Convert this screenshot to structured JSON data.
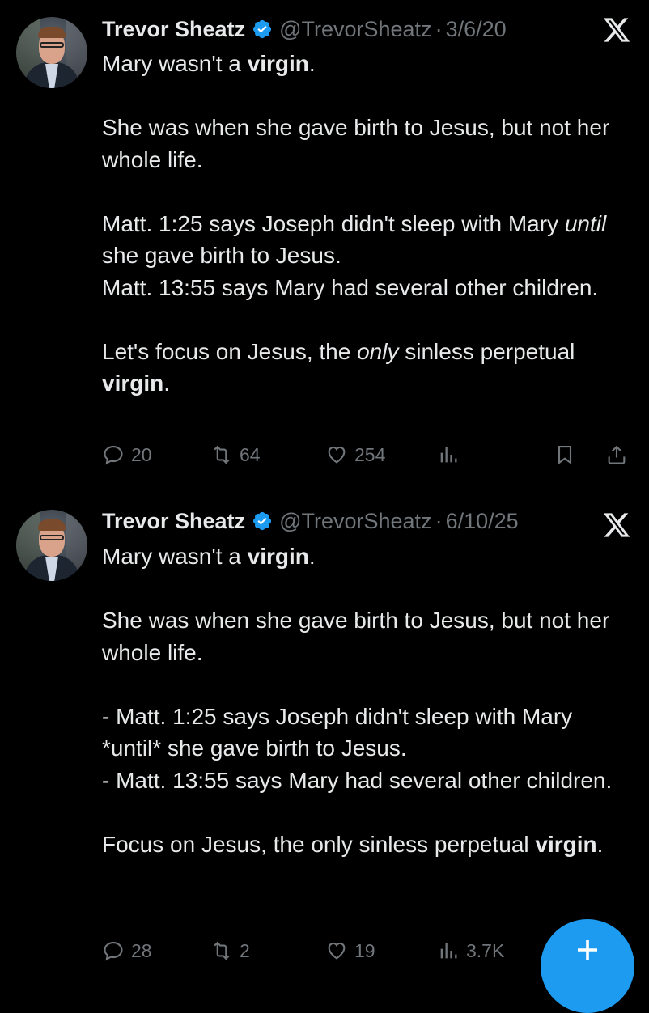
{
  "tweets": [
    {
      "name": "Trevor Sheatz",
      "handle": "@TrevorSheatz",
      "sep": "·",
      "date": "3/6/20",
      "p1_a": "Mary wasn't a ",
      "p1_b": "virgin",
      "p1_c": ".",
      "p2": "She was when she gave birth to Jesus, but not her whole life.",
      "p3_a": "Matt. 1:25 says Joseph didn't sleep with Mary ",
      "p3_b": "until",
      "p3_c": " she gave birth to Jesus.",
      "p4": "Matt. 13:55 says Mary had several other children.",
      "p5_a": "Let's focus on Jesus, the ",
      "p5_b": "only",
      "p5_c": " sinless perpetual ",
      "p5_d": "virgin",
      "p5_e": ".",
      "replies": "20",
      "retweets": "64",
      "likes": "254",
      "views": ""
    },
    {
      "name": "Trevor Sheatz",
      "handle": "@TrevorSheatz",
      "sep": "·",
      "date": "6/10/25",
      "p1_a": "Mary wasn't a ",
      "p1_b": "virgin",
      "p1_c": ".",
      "p2": "She was when she gave birth to Jesus, but not her whole life.",
      "p3": "- Matt. 1:25 says Joseph didn't sleep with Mary *until* she gave birth to Jesus.",
      "p4": "- Matt. 13:55 says Mary had several other children.",
      "p5_a": "Focus on Jesus, the only sinless perpetual ",
      "p5_b": "virgin",
      "p5_c": ".",
      "replies": "28",
      "retweets": "2",
      "likes": "19",
      "views": "3.7K"
    }
  ],
  "icons": {
    "verified": "verified-badge-icon",
    "x_logo": "x-logo-icon",
    "reply": "reply-icon",
    "retweet": "retweet-icon",
    "like": "heart-icon",
    "views": "views-icon",
    "bookmark": "bookmark-icon",
    "share": "share-icon",
    "compose": "plus-icon"
  },
  "colors": {
    "background": "#000000",
    "text": "#e7e9ea",
    "muted": "#71767b",
    "accent": "#1d9bf0",
    "divider": "#2f3336"
  }
}
